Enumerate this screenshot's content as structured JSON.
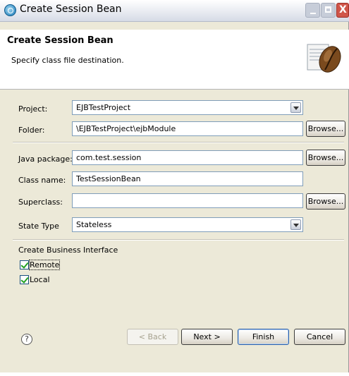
{
  "window": {
    "title": "Create Session Bean"
  },
  "header": {
    "title": "Create Session Bean",
    "subtitle": "Specify class file destination.",
    "icon": "coffee-bean-icon"
  },
  "form": {
    "project_label": "Project:",
    "project_value": "EJBTestProject",
    "folder_label": "Folder:",
    "folder_value": "\\EJBTestProject\\ejbModule",
    "java_package_label": "Java package:",
    "java_package_value": "com.test.session",
    "class_name_label": "Class name:",
    "class_name_value": "TestSessionBean",
    "superclass_label": "Superclass:",
    "superclass_value": "",
    "state_type_label": "State Type",
    "state_type_value": "Stateless",
    "browse_label": "Browse..."
  },
  "business_interface": {
    "label": "Create Business Interface",
    "remote_label": "Remote",
    "remote_checked": true,
    "local_label": "Local",
    "local_checked": true
  },
  "footer": {
    "help_symbol": "?",
    "back_label": "< Back",
    "next_label": "Next >",
    "finish_label": "Finish",
    "cancel_label": "Cancel"
  },
  "colors": {
    "dialog_bg": "#ece9d8",
    "field_border": "#7f9db9",
    "check_green": "#21a121"
  }
}
